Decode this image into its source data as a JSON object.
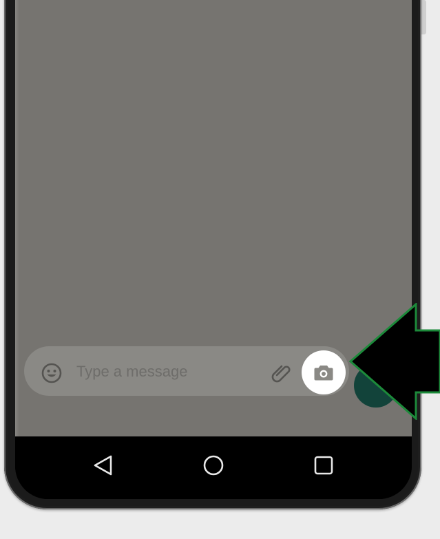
{
  "composer": {
    "placeholder": "Type a message",
    "emoji_icon": "emoji-icon",
    "attach_icon": "paperclip-icon",
    "camera_icon": "camera-icon",
    "send_icon": "microphone-icon"
  },
  "nav_bar": {
    "back_icon": "triangle-back-icon",
    "home_icon": "circle-home-icon",
    "recents_icon": "square-recents-icon"
  },
  "annotation": {
    "pointer": "arrow-pointer-icon",
    "arrow_fill": "#000000",
    "arrow_outline": "#1c8a3a"
  },
  "colors": {
    "dim_overlay": "#767470",
    "camera_button": "#ffffff",
    "send_button": "#12433a"
  }
}
